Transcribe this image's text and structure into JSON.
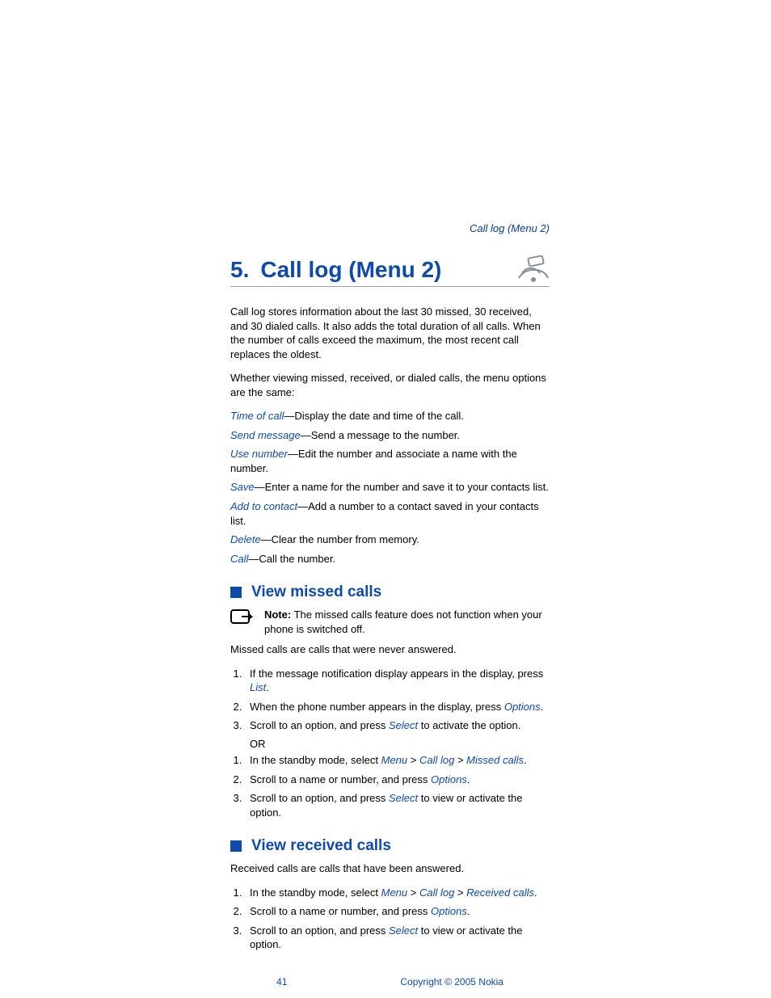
{
  "running_head": "Call log (Menu 2)",
  "chapter": {
    "number": "5.",
    "title": "Call log (Menu 2)"
  },
  "intro": [
    "Call log stores information about the last 30 missed, 30 received, and 30 dialed calls. It also adds the total duration of all calls. When the number of calls exceed the maximum, the most recent call replaces the oldest.",
    "Whether viewing missed, received, or dialed calls, the menu options are the same:"
  ],
  "options": [
    {
      "name": "Time of call",
      "desc": "—Display the date and time of the call."
    },
    {
      "name": "Send message",
      "desc": "—Send a message to the number."
    },
    {
      "name": "Use number",
      "desc": "—Edit the number and associate a name with the number."
    },
    {
      "name": "Save",
      "desc": "—Enter a name for the number and save it to your contacts list."
    },
    {
      "name": "Add to contact",
      "desc": "—Add a number to a contact saved in your contacts list."
    },
    {
      "name": "Delete",
      "desc": "—Clear the number from memory."
    },
    {
      "name": "Call",
      "desc": "—Call the number."
    }
  ],
  "section_missed": {
    "title": "View missed calls",
    "note_label": "Note:",
    "note_text": " The missed calls feature does not function when your phone is switched off.",
    "lead": "Missed calls are calls that were never answered.",
    "steps_a": {
      "s1_pre": "If the message notification display appears in the display, press ",
      "s1_link": "List",
      "s1_post": ".",
      "s2_pre": "When the phone number appears in the display, press ",
      "s2_link": "Options",
      "s2_post": ".",
      "s3_pre": "Scroll to an option, and press ",
      "s3_link": "Select",
      "s3_post": " to activate the option."
    },
    "or": "OR",
    "steps_b": {
      "s1_pre": "In the standby mode, select ",
      "s1_l1": "Menu",
      "s1_gt1": " > ",
      "s1_l2": "Call log",
      "s1_gt2": " > ",
      "s1_l3": "Missed calls",
      "s1_post": ".",
      "s2_pre": "Scroll to a name or number, and press ",
      "s2_link": "Options",
      "s2_post": ".",
      "s3_pre": "Scroll to an option, and press ",
      "s3_link": "Select",
      "s3_post": " to view or activate the option."
    }
  },
  "section_received": {
    "title": "View received calls",
    "lead": "Received calls are calls that have been answered.",
    "steps": {
      "s1_pre": "In the standby mode, select ",
      "s1_l1": "Menu",
      "s1_gt1": " > ",
      "s1_l2": "Call log",
      "s1_gt2": " > ",
      "s1_l3": "Received calls",
      "s1_post": ".",
      "s2_pre": "Scroll to a name or number, and press ",
      "s2_link": "Options",
      "s2_post": ".",
      "s3_pre": "Scroll to an option, and press ",
      "s3_link": "Select",
      "s3_post": " to view or activate the option."
    }
  },
  "footer": {
    "page": "41",
    "copyright": "Copyright © 2005 Nokia"
  }
}
